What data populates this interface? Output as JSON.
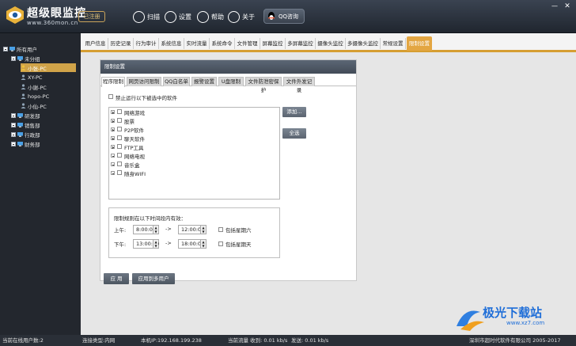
{
  "header": {
    "brand": "超级眼监控",
    "url": "www.360mon.cn",
    "register": "已注册",
    "tools": [
      {
        "label": "扫描",
        "icon": "scan-icon"
      },
      {
        "label": "设置",
        "icon": "gear-icon"
      },
      {
        "label": "帮助",
        "icon": "help-icon"
      },
      {
        "label": "关于",
        "icon": "info-icon"
      }
    ],
    "qq": "QQ咨询"
  },
  "sidebar": {
    "root": "所有用户",
    "group_unassigned": "未分组",
    "users": [
      "小张-PC",
      "XY-PC",
      "小谢-PC",
      "hopo-PC",
      "小仙-PC"
    ],
    "departments": [
      "研发部",
      "销售部",
      "行政部",
      "财务部"
    ]
  },
  "nav": {
    "tabs": [
      "用户信息",
      "历史记录",
      "行为审计",
      "系统信息",
      "实时流量",
      "系统命令",
      "文件管理",
      "屏幕监控",
      "多屏幕监控",
      "摄像头监控",
      "多摄像头监控",
      "常规设置",
      "限制设置"
    ],
    "active_index": 12
  },
  "panel": {
    "title": "限制设置",
    "sub_tabs": [
      "程序限制",
      "网页访问限制",
      "QQ白名单",
      "报警设置",
      "U盘限制",
      "文件防泄密保护",
      "文件外发记录"
    ],
    "active_sub_tab": 0,
    "forbid_label": "禁止运行以下被选中的软件",
    "software": [
      {
        "name": "网络游戏",
        "expandable": true
      },
      {
        "name": "股票",
        "expandable": true
      },
      {
        "name": "P2P软件",
        "expandable": true
      },
      {
        "name": "聊天软件",
        "expandable": true
      },
      {
        "name": "FTP工具",
        "expandable": true
      },
      {
        "name": "网络电视",
        "expandable": false
      },
      {
        "name": "音乐盒",
        "expandable": false
      },
      {
        "name": "随身WIFI",
        "expandable": false
      }
    ],
    "add_button": "添加...",
    "select_all_button": "全选",
    "time_title": "限制规则在以下时间段内有效：",
    "morning_label": "上午:",
    "afternoon_label": "下午:",
    "morning_start": "8:00:00",
    "morning_end": "12:00:00",
    "afternoon_start": "13:00:00",
    "afternoon_end": "18:00:00",
    "arrow": "->",
    "saturday": "包括星期六",
    "sunday": "包括星期天",
    "apply_button": "应 用",
    "apply_sync_button": "应用到多用户"
  },
  "status": {
    "online": "当前在线用户数:2",
    "connection": "连接类型:内网",
    "ip": "本机IP:192.168.199.238",
    "recv": "当前流量 收到: 0.01 kb/s",
    "send": "发送: 0.01 kb/s",
    "copyright": "深圳市超时代软件有限公司 2005-2017"
  },
  "watermark": {
    "text": "极光下载站",
    "url": "www.xz7.com"
  },
  "colors": {
    "accent": "#e3a642",
    "header": "#2b323c",
    "sidebar": "#23272e"
  }
}
